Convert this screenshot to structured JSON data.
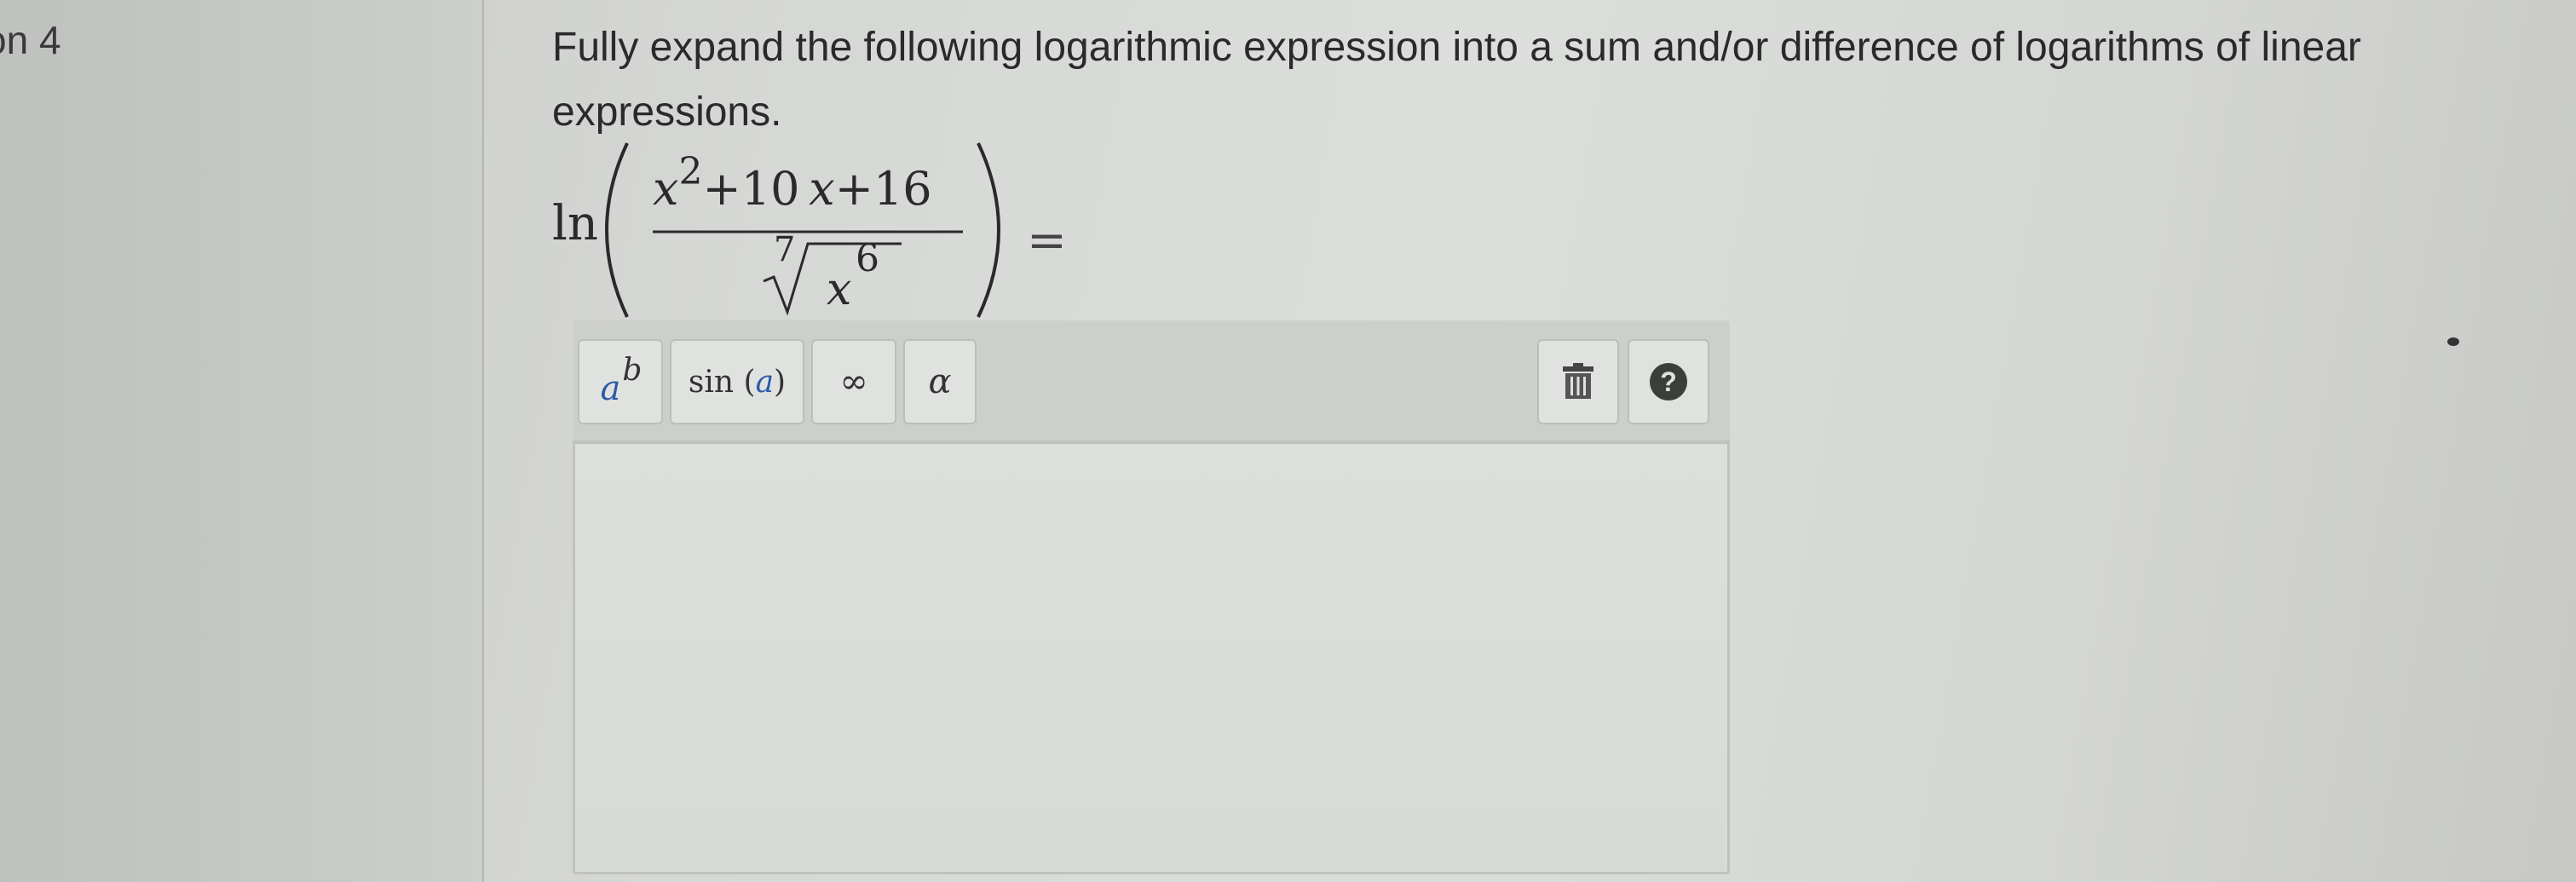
{
  "question": {
    "number_label": "on 4",
    "prompt": "Fully expand the following logarithmic expression into a sum and/or difference of logarithms of linear expressions."
  },
  "expression": {
    "function": "ln",
    "numerator": {
      "var": "x",
      "exponent": "2",
      "rest": "+10",
      "var2": "x",
      "tail": "+16"
    },
    "denominator": {
      "root_index": "7",
      "radicand_var": "x",
      "radicand_exponent": "6"
    },
    "equals": "="
  },
  "toolbar": {
    "power": {
      "base": "a",
      "exponent": "b",
      "icon": "power-icon"
    },
    "sin": {
      "label": "sin",
      "arg": "a"
    },
    "infinity": {
      "label": "∞"
    },
    "alpha": {
      "label": "α"
    },
    "trash": {
      "icon": "trash-icon"
    },
    "help": {
      "label": "?",
      "icon": "help-icon"
    }
  },
  "answer": {
    "value": ""
  },
  "colors": {
    "accent": "#2b5aa8",
    "help_bg": "#3c3e3c"
  }
}
